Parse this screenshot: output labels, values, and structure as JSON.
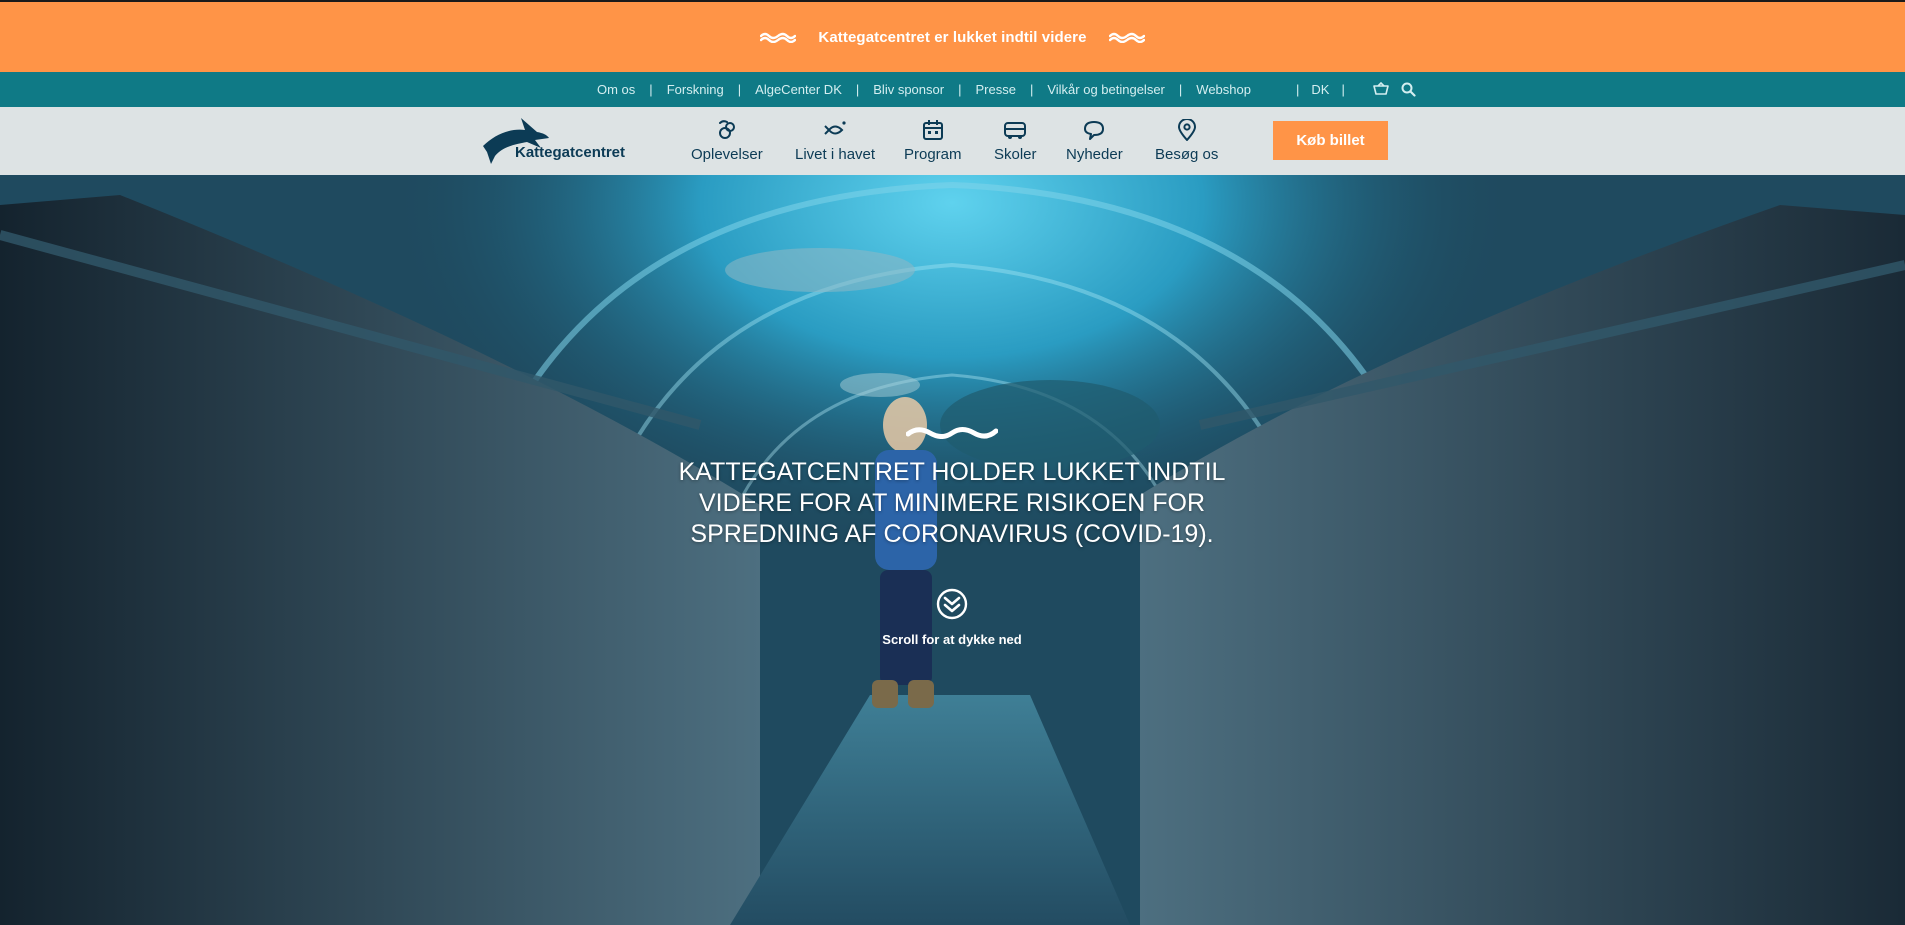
{
  "alert": {
    "text": "Kattegatcentret er lukket indtil videre",
    "left_icon": "wave-icon",
    "right_icon": "wave-icon",
    "background": "#ff9447"
  },
  "top_nav": {
    "links": [
      {
        "label": "Om os"
      },
      {
        "label": "Forskning"
      },
      {
        "label": "AlgeCenter DK"
      },
      {
        "label": "Bliv sponsor"
      },
      {
        "label": "Presse"
      },
      {
        "label": "Vilkår og betingelser"
      },
      {
        "label": "Webshop"
      }
    ],
    "separator": "|",
    "language": "DK",
    "cart_icon": "basket-icon",
    "search_icon": "search-icon",
    "background": "#0f7a86"
  },
  "header": {
    "logo_text": "Kattegatcentret",
    "logo_icon": "shark-logo-icon",
    "nav": [
      {
        "label": "Oplevelser",
        "icon": "experiences-icon"
      },
      {
        "label": "Livet i havet",
        "icon": "fish-icon"
      },
      {
        "label": "Program",
        "icon": "calendar-icon"
      },
      {
        "label": "Skoler",
        "icon": "bus-icon"
      },
      {
        "label": "Nyheder",
        "icon": "speech-bubble-icon"
      },
      {
        "label": "Besøg os",
        "icon": "location-pin-icon"
      }
    ],
    "buy_button": "Køb billet",
    "accent": "#ff9447",
    "text_color": "#0c3b55"
  },
  "hero": {
    "title": "KATTEGATCENTRET HOLDER LUKKET INDTIL VIDERE FOR AT MINIMERE RISIKOEN FOR SPREDNING AF CORONAVIRUS (COVID-19).",
    "scroll_text": "Scroll for at dykke ned",
    "scroll_icon": "chevron-double-down-icon",
    "wave_icon": "wave-icon"
  }
}
